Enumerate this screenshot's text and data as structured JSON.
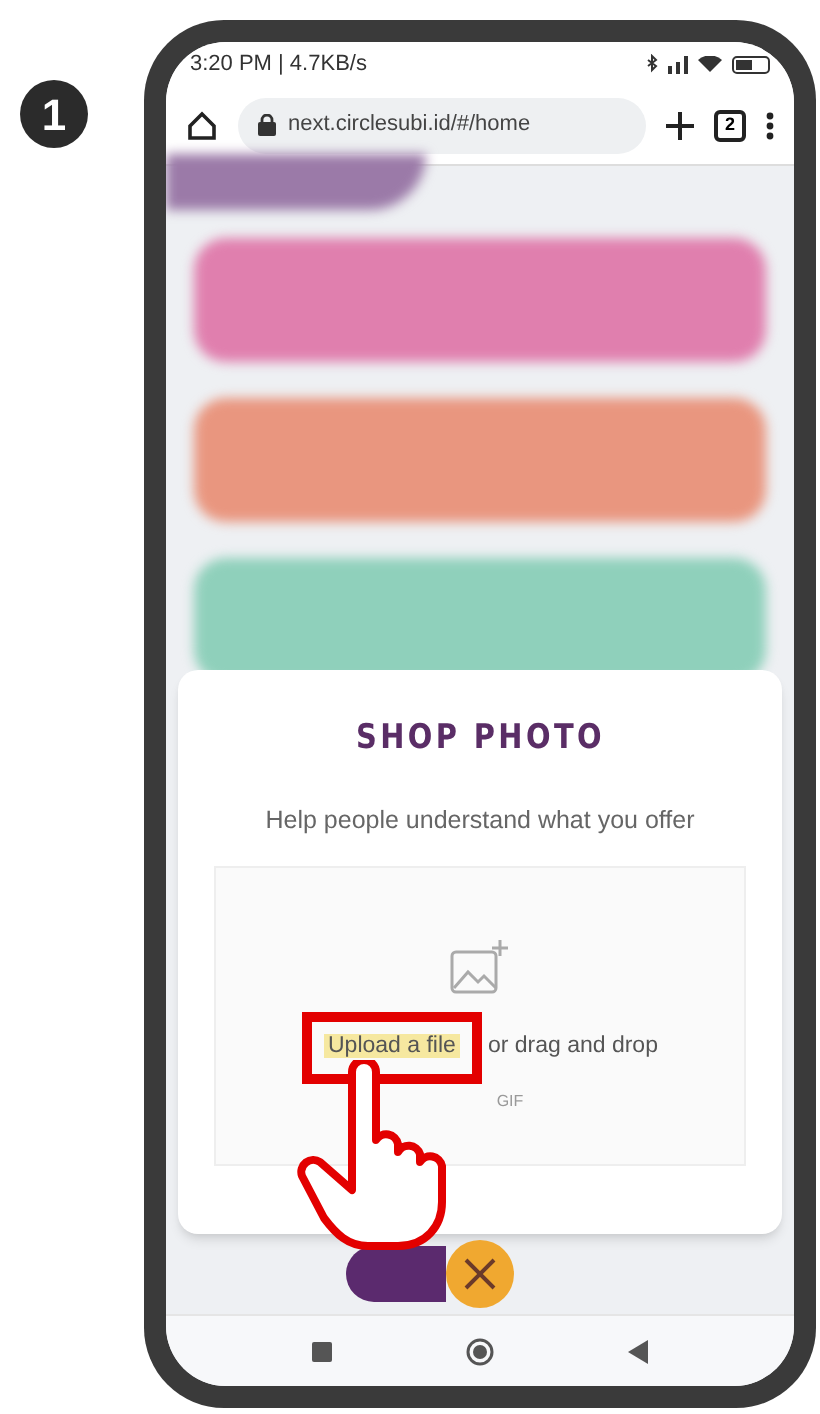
{
  "step_badge": "1",
  "status_bar": {
    "time_speed": "3:20 PM | 4.7KB/s"
  },
  "browser": {
    "url": "next.circlesubi.id/#/home",
    "tab_count": "2"
  },
  "background_cards": [
    {
      "color": "#e07fae"
    },
    {
      "color": "#e9967f"
    },
    {
      "color": "#8fd0bb"
    }
  ],
  "dialog": {
    "title": "SHOP PHOTO",
    "subtitle": "Help people understand what you offer",
    "upload_link": "Upload a file",
    "upload_rest": "or drag and drop",
    "formats": "GIF",
    "highlighted": true
  }
}
